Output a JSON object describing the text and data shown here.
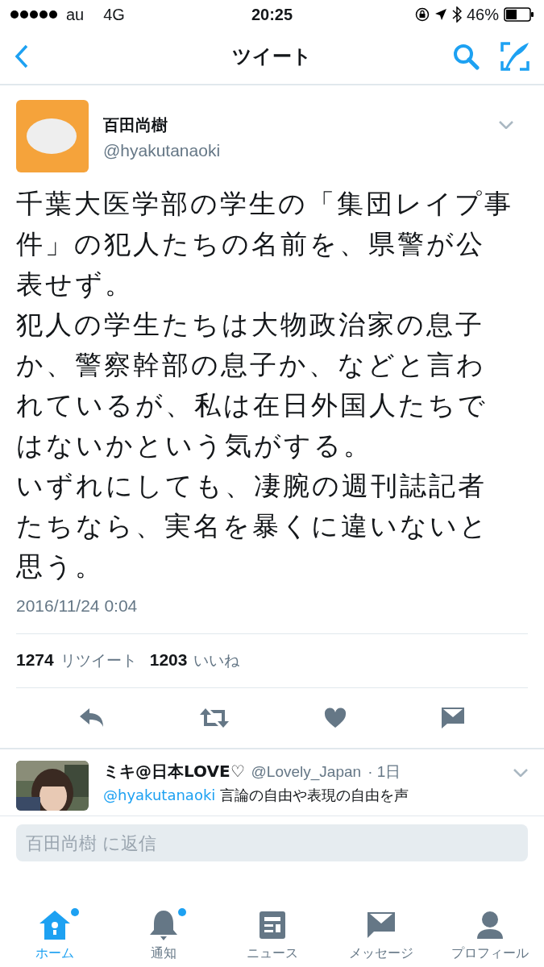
{
  "status_bar": {
    "carrier": "au",
    "network": "4G",
    "time": "20:25",
    "battery": "46%"
  },
  "nav": {
    "title": "ツイート"
  },
  "tweet": {
    "name": "百田尚樹",
    "handle": "@hyakutanaoki",
    "paragraphs": [
      "千葉大医学部の学生の「集団レイプ事件」の犯人たちの名前を、県警が公表せず。",
      "犯人の学生たちは大物政治家の息子か、警察幹部の息子か、などと言われているが、私は在日外国人たちではないかという気がする。",
      "いずれにしても、凄腕の週刊誌記者たちなら、実名を暴くに違いないと思う。"
    ],
    "timestamp": "2016/11/24 0:04",
    "stats": [
      {
        "count": "1274",
        "label": "リツイート"
      },
      {
        "count": "1203",
        "label": "いいね"
      }
    ]
  },
  "reply": {
    "name": "ミキ@日本LOVE♡",
    "handle": "@Lovely_Japan",
    "time": "· 1日",
    "mention": "@hyakutanaoki",
    "text": "言論の自由や表現の自由を声"
  },
  "reply_field": {
    "placeholder": "百田尚樹 に返信"
  },
  "tab_bar": [
    {
      "label": "ホーム",
      "selected": true,
      "badge": true
    },
    {
      "label": "通知",
      "selected": false,
      "badge": true
    },
    {
      "label": "ニュース",
      "selected": false,
      "badge": false
    },
    {
      "label": "メッセージ",
      "selected": false,
      "badge": false
    },
    {
      "label": "プロフィール",
      "selected": false,
      "badge": false
    }
  ]
}
